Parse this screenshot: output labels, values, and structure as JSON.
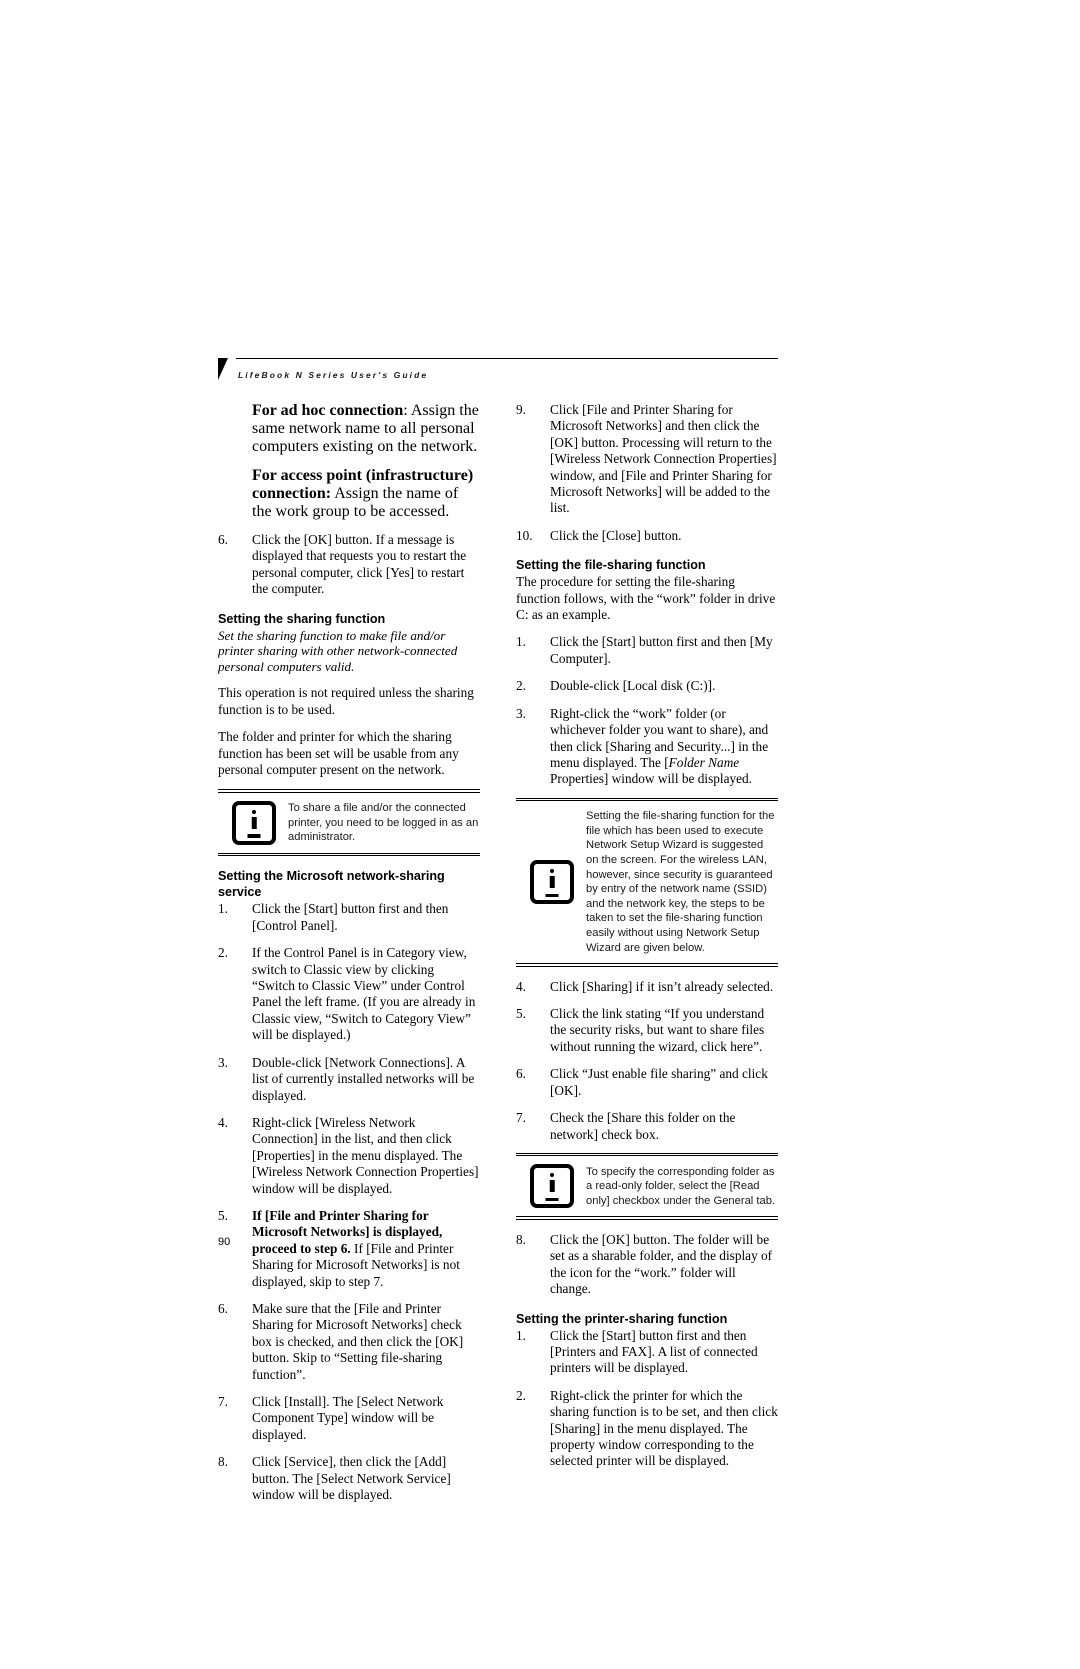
{
  "header": {
    "title": "LifeBook N Series User's Guide"
  },
  "page_number": "90",
  "left_column": {
    "callout_adhoc": {
      "lead": "For ad hoc connection",
      "text": ": Assign the same network name to all personal computers existing on the network."
    },
    "callout_accesspoint": {
      "lead": "For access point (infrastructure) connection:",
      "text": " Assign the name of the work group to be accessed."
    },
    "step6": {
      "num": "6.",
      "text": "Click the [OK] button. If a message is displayed that requests you to restart the personal computer, click [Yes] to restart the computer."
    },
    "heading_sharing": "Setting the sharing function",
    "italic_sharing": "Set the sharing function to make file and/or printer sharing with other network-connected personal computers valid.",
    "para_not_required": "This operation is not required unless the sharing function is to be used.",
    "para_folder_printer": "The folder and printer for which the sharing function has been set will be usable from any personal computer present on the network.",
    "note_admin": "To share a file and/or the connected printer, you need to be logged in as an administrator.",
    "heading_ms_service": "Setting the Microsoft network-sharing service",
    "steps": [
      {
        "num": "1.",
        "text": "Click the [Start] button first and then [Control Panel]."
      },
      {
        "num": "2.",
        "text": "If the Control Panel is in Category view, switch to Classic view by clicking “Switch to Classic View” under Control Panel the left frame. (If you are already in Classic view, “Switch to Category View” will be displayed.)"
      },
      {
        "num": "3.",
        "text": "Double-click [Network Connections]. A list of currently installed networks will be displayed."
      },
      {
        "num": "4.",
        "text": "Right-click [Wireless Network Connection] in the list, and then click [Properties] in the menu displayed. The [Wireless Network Connection Properties] window will be displayed."
      },
      {
        "num": "5.",
        "bold_part": "If [File and Printer Sharing for Microsoft Networks] is displayed, proceed to step 6.",
        "rest": " If [File and Printer Sharing for Microsoft Networks] is not displayed, skip to step 7."
      },
      {
        "num": "6.",
        "text": "Make sure that the [File and Printer Sharing for Microsoft Networks] check box is checked, and then click the [OK] button. Skip to “Setting file-sharing function”."
      },
      {
        "num": "7.",
        "text": "Click [Install]. The [Select Network Component Type] window will be displayed."
      },
      {
        "num": "8.",
        "text": "Click [Service], then click the [Add] button. The [Select Network Service] window will be displayed."
      }
    ]
  },
  "right_column": {
    "step9": {
      "num": "9.",
      "text": "Click [File and Printer Sharing for Microsoft Networks] and then click the [OK] button. Processing will return to the [Wireless Network Connection Properties] window, and [File and Printer Sharing for Microsoft Networks] will be added to the list."
    },
    "step10": {
      "num": "10.",
      "text": "Click the [Close] button."
    },
    "heading_file_sharing": "Setting the file-sharing function",
    "para_procedure": "The procedure for setting the file-sharing function follows, with the “work” folder in drive C: as an example.",
    "steps_a": [
      {
        "num": "1.",
        "text": "Click the [Start] button first and then [My Computer]."
      },
      {
        "num": "2.",
        "text": "Double-click [Local disk (C:)]."
      },
      {
        "num": "3.",
        "pre": "Right-click the “work” folder (or whichever folder you want to share), and then click [Sharing and Security...] in the menu displayed. The [",
        "italic": "Folder Name",
        "post": " Properties] window will be displayed."
      }
    ],
    "note_wizard": "Setting the file-sharing function for the file which has been used to execute Network Setup Wizard is suggested on the screen. For the wireless LAN, however, since security is guaranteed by entry of the network name (SSID) and the network key, the steps to be taken to set the file-sharing function easily without using Network Setup Wizard are given below.",
    "steps_b": [
      {
        "num": "4.",
        "text": "Click [Sharing] if it isn’t already selected."
      },
      {
        "num": "5.",
        "text": "Click the link stating “If you understand the security risks, but want to share files without running the wizard, click here”."
      },
      {
        "num": "6.",
        "text": "Click “Just enable file sharing” and click [OK]."
      },
      {
        "num": "7.",
        "text": "Check the [Share this folder on the network] check box."
      }
    ],
    "note_readonly": "To specify the corresponding folder as a read-only folder, select the [Read only] checkbox under the General tab.",
    "step8": {
      "num": "8.",
      "text": "Click the [OK] button. The folder will be set as a sharable folder, and the display of the icon for the “work.” folder will change."
    },
    "heading_printer_sharing": "Setting the printer-sharing function",
    "steps_c": [
      {
        "num": "1.",
        "text": "Click the [Start] button first and then [Printers and FAX]. A list of connected printers will be displayed."
      },
      {
        "num": "2.",
        "text": "Right-click the printer for which the sharing function is to be set, and then click [Sharing] in the menu displayed. The property window corresponding to the selected printer will be displayed."
      }
    ]
  }
}
